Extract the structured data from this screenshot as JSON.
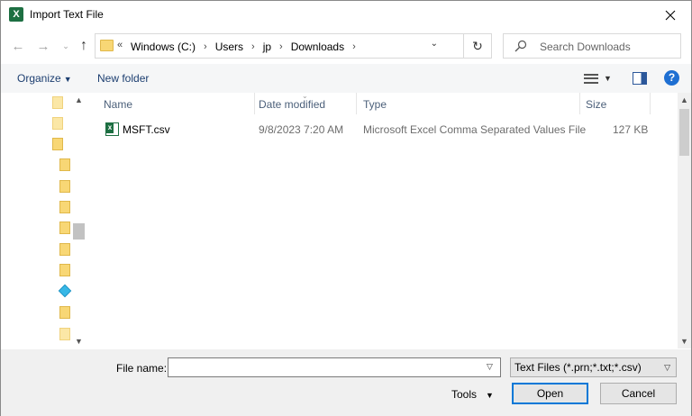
{
  "window": {
    "title": "Import Text File",
    "app_icon_letter": "X"
  },
  "nav": {
    "back_glyph": "←",
    "forward_glyph": "→",
    "recent_glyph": "⌄",
    "up_glyph": "↑"
  },
  "address": {
    "overflow": "«",
    "crumbs": [
      "Windows (C:)",
      "Users",
      "jp",
      "Downloads"
    ],
    "separator": "›",
    "dropdown_glyph": "⌄",
    "refresh_glyph": "↻"
  },
  "search": {
    "placeholder": "Search Downloads"
  },
  "toolbar": {
    "organize_label": "Organize",
    "new_folder_label": "New folder",
    "help_label": "?"
  },
  "columns": {
    "name": "Name",
    "date_modified": "Date modified",
    "type": "Type",
    "size": "Size"
  },
  "files": [
    {
      "name": "MSFT.csv",
      "date_modified": "9/8/2023 7:20 AM",
      "type": "Microsoft Excel Comma Separated Values File",
      "size": "127 KB"
    }
  ],
  "navigation_pane": {
    "icons": [
      "folder-icon",
      "shortcut-folder-icon",
      "folder-icon",
      "folder-icon",
      "folder-icon",
      "folder-icon",
      "folder-icon",
      "folder-icon",
      "folder-icon",
      "3d-objects-icon",
      "folder-icon",
      "folder-icon"
    ]
  },
  "bottom": {
    "file_name_label": "File name:",
    "file_name_value": "",
    "filter_value": "Text Files (*.prn;*.txt;*.csv)",
    "tools_label": "Tools",
    "open_label": "Open",
    "cancel_label": "Cancel"
  },
  "colors": {
    "accent": "#0078d7",
    "excel_green": "#1d6f42",
    "folder_yellow": "#f8d775",
    "link_blue": "#1c3e70"
  }
}
